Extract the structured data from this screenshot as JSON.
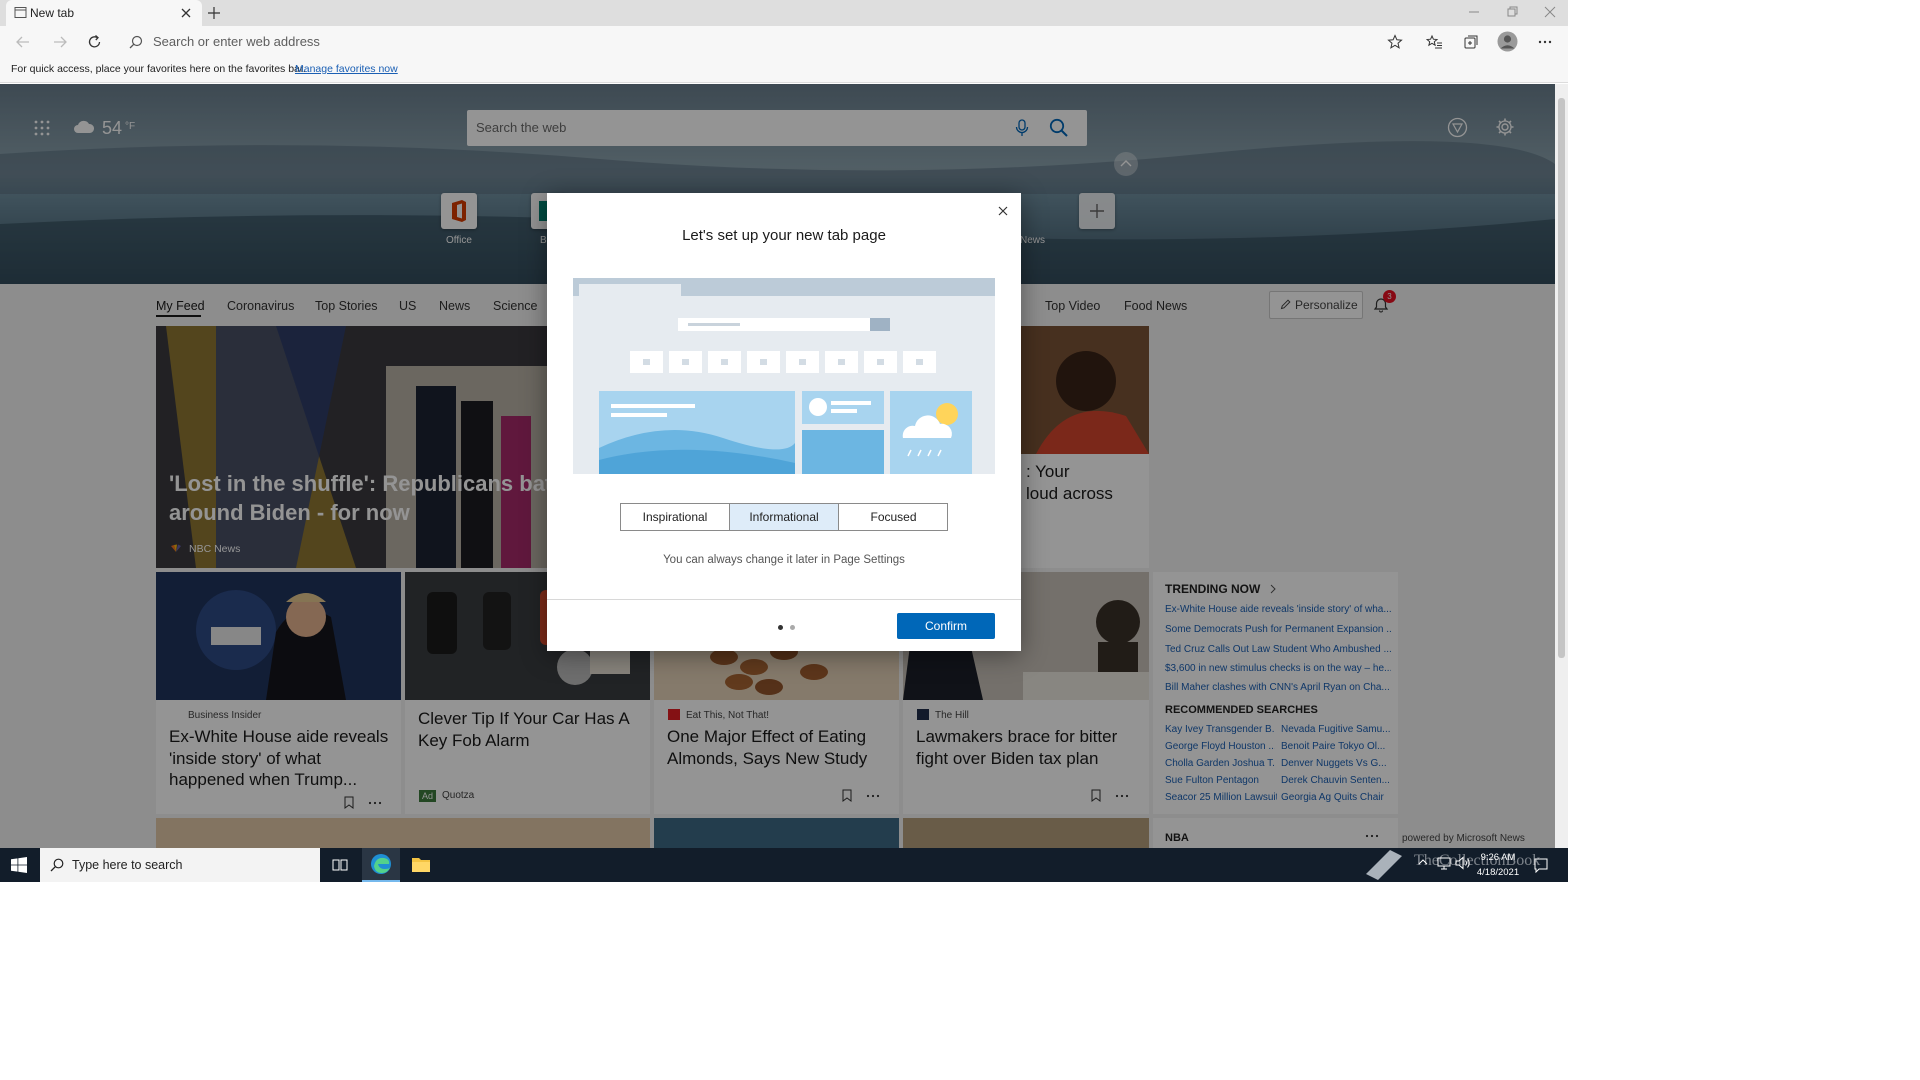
{
  "browser": {
    "tab_title": "New tab",
    "address_placeholder": "Search or enter web address",
    "favbar_text": "For quick access, place your favorites here on the favorites bar.",
    "favbar_link": "Manage favorites now"
  },
  "header": {
    "temperature": "54",
    "temperature_unit": "°F",
    "search_placeholder": "Search the web"
  },
  "quick_links": [
    {
      "label": "Office",
      "icon": "office-icon"
    },
    {
      "label": "B",
      "icon": "bing-icon"
    },
    {
      "label": "News",
      "icon": "news-icon"
    }
  ],
  "feed_nav": {
    "items": [
      "My Feed",
      "Coronavirus",
      "Top Stories",
      "US",
      "News",
      "Science",
      "Top Video",
      "Food News"
    ],
    "active": "My Feed",
    "personalize_label": "Personalize",
    "notification_count": "3"
  },
  "hero_card": {
    "title_line1": "'Lost in the shuffle': Republicans batt",
    "title_line2": "around Biden - for now",
    "source": "NBC News"
  },
  "side_card": {
    "title_line1": ": Your",
    "title_line2": "loud across"
  },
  "cards": [
    {
      "source": "Business Insider",
      "title": "Ex-White House aide reveals 'inside story' of what happened when Trump..."
    },
    {
      "source": "Quotza",
      "title": "Clever Tip If Your Car Has A Key Fob Alarm",
      "ad_label": "Ad"
    },
    {
      "source": "Eat This, Not That!",
      "title": "One Major Effect of Eating Almonds, Says New Study"
    },
    {
      "source": "The Hill",
      "title": "Lawmakers brace for bitter fight over Biden tax plan"
    }
  ],
  "trending": {
    "heading": "TRENDING NOW",
    "items": [
      "Ex-White House aide reveals 'inside story' of wha...",
      "Some Democrats Push for Permanent Expansion ...",
      "Ted Cruz Calls Out Law Student Who Ambushed ...",
      "$3,600 in new stimulus checks is on the way – he...",
      "Bill Maher clashes with CNN's April Ryan on Cha..."
    ],
    "recommended_heading": "RECOMMENDED SEARCHES",
    "recommended": [
      "Kay Ivey Transgender B...",
      "Nevada Fugitive Samu...",
      "George Floyd Houston ...",
      "Benoit Paire Tokyo Ol...",
      "Cholla Garden Joshua T...",
      "Denver Nuggets Vs G...",
      "Sue Fulton Pentagon",
      "Derek Chauvin Senten...",
      "Seacor 25 Million Lawsuit",
      "Georgia Ag Quits Chair"
    ],
    "bottom_label": "NBA",
    "powered_by": "powered by Microsoft News"
  },
  "dialog": {
    "title": "Let's set up your new tab page",
    "options": [
      "Inspirational",
      "Informational",
      "Focused"
    ],
    "selected_option": "Informational",
    "hint": "You can always change it later in Page Settings",
    "confirm_label": "Confirm",
    "page_indicator": {
      "current": 1,
      "total": 2
    }
  },
  "taskbar": {
    "search_placeholder": "Type here to search",
    "time": "9:26 AM",
    "date": "4/18/2021",
    "watermark": "TheCollectionBook"
  },
  "colors": {
    "accent": "#0067b8",
    "link": "#1a5fb4",
    "notification_badge": "#e81123",
    "taskbar": "#121d2a"
  }
}
